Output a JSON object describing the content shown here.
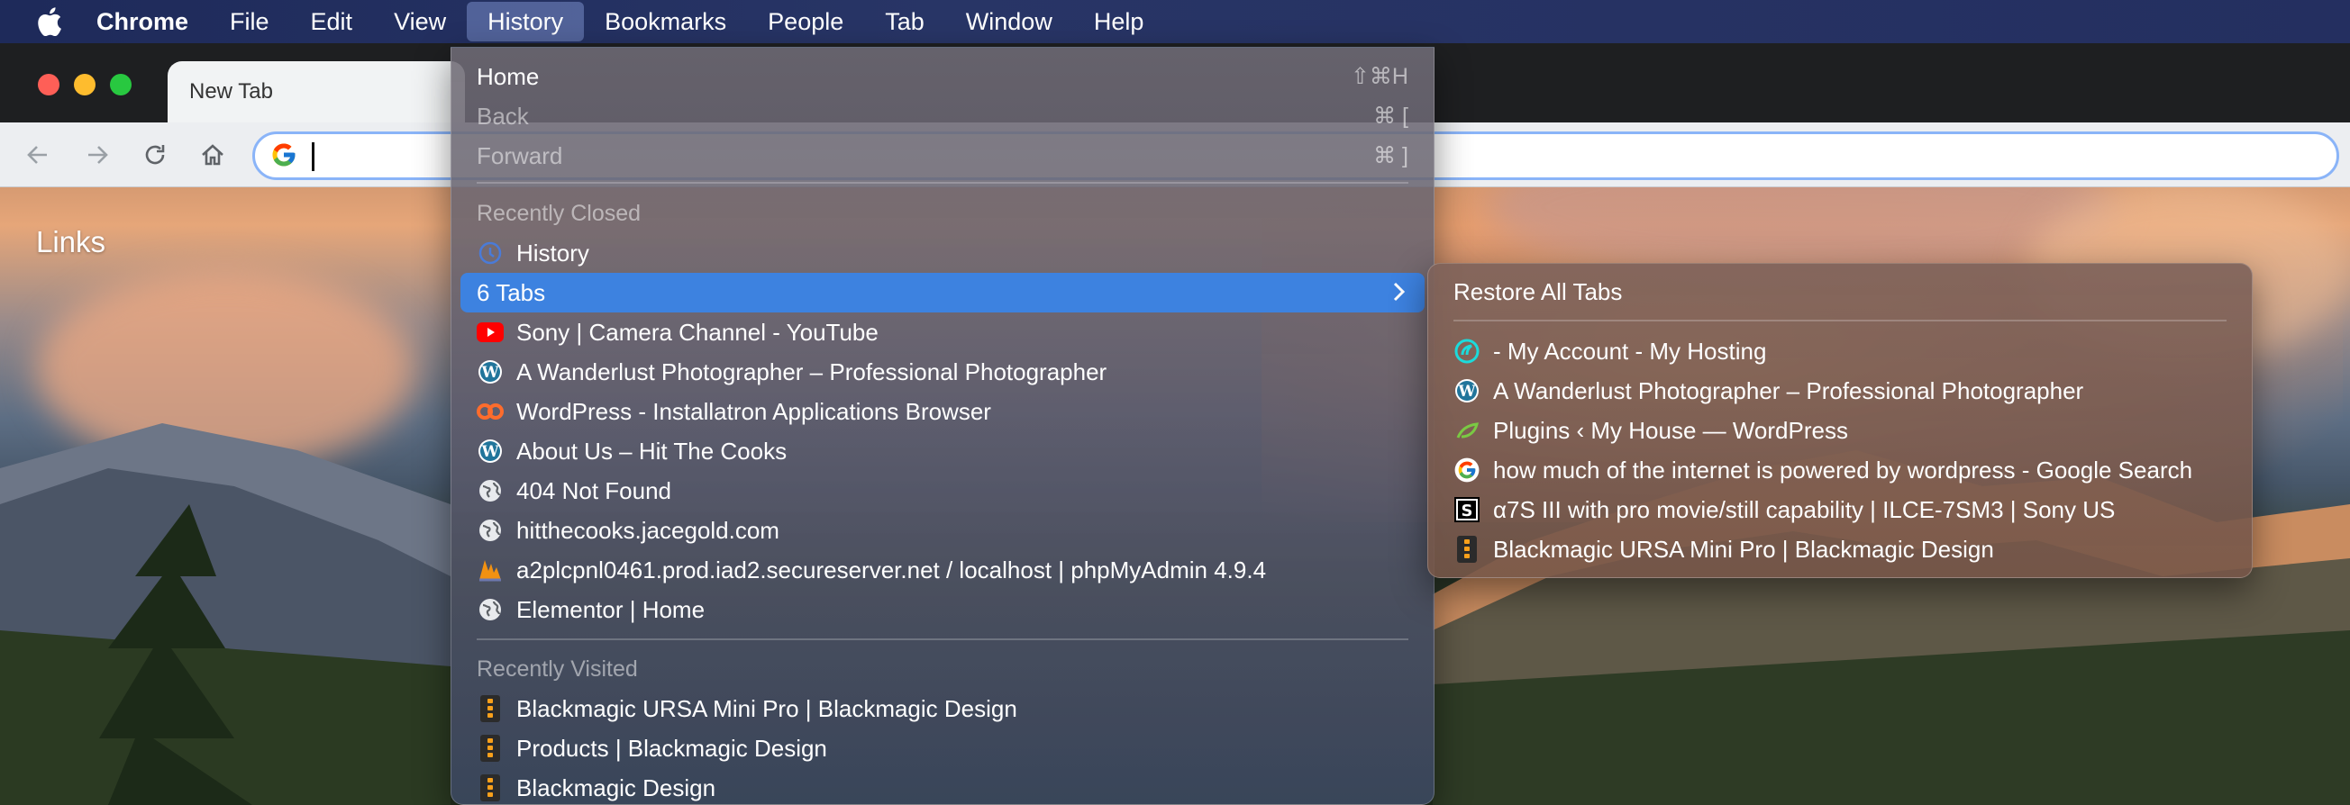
{
  "menubar": {
    "app": "Chrome",
    "items": [
      "File",
      "Edit",
      "View",
      "History",
      "Bookmarks",
      "People",
      "Tab",
      "Window",
      "Help"
    ]
  },
  "browser": {
    "tab_title": "New Tab",
    "omnibox_value": "",
    "links_label": "Links"
  },
  "history_menu": {
    "home": {
      "label": "Home",
      "shortcut": "⇧⌘H"
    },
    "back": {
      "label": "Back",
      "shortcut": "⌘ ["
    },
    "forward": {
      "label": "Forward",
      "shortcut": "⌘ ]"
    },
    "recently_closed_header": "Recently Closed",
    "recently_closed": [
      {
        "label": "History",
        "icon": "history-icon"
      },
      {
        "label": "6 Tabs",
        "icon": ""
      },
      {
        "label": "Sony | Camera Channel - YouTube",
        "icon": "youtube-icon"
      },
      {
        "label": "A Wanderlust Photographer – Professional Photographer",
        "icon": "wordpress-icon"
      },
      {
        "label": "WordPress - Installatron Applications Browser",
        "icon": "cpanel-icon"
      },
      {
        "label": "About Us – Hit The Cooks",
        "icon": "wordpress-icon"
      },
      {
        "label": "404 Not Found",
        "icon": "globe-icon"
      },
      {
        "label": "hitthecooks.jacegold.com",
        "icon": "globe-icon"
      },
      {
        "label": "a2plcpnl0461.prod.iad2.secureserver.net / localhost | phpMyAdmin 4.9.4",
        "icon": "phpmyadmin-icon"
      },
      {
        "label": "Elementor | Home",
        "icon": "globe-icon"
      }
    ],
    "recently_visited_header": "Recently Visited",
    "recently_visited": [
      {
        "label": "Blackmagic URSA Mini Pro | Blackmagic Design",
        "icon": "blackmagic-icon"
      },
      {
        "label": "Products | Blackmagic Design",
        "icon": "blackmagic-icon"
      },
      {
        "label": "Blackmagic Design",
        "icon": "blackmagic-icon"
      }
    ]
  },
  "tabs_submenu": {
    "restore_all": "Restore All Tabs",
    "items": [
      {
        "label": "- My Account - My Hosting",
        "icon": "hosting-icon"
      },
      {
        "label": "A Wanderlust Photographer – Professional Photographer",
        "icon": "wordpress-icon"
      },
      {
        "label": "Plugins ‹ My House — WordPress",
        "icon": "leaf-icon"
      },
      {
        "label": "how much of the internet is powered by wordpress - Google Search",
        "icon": "google-icon"
      },
      {
        "label": "α7S III with pro movie/still capability | ILCE-7SM3 | Sony US",
        "icon": "sony-icon"
      },
      {
        "label": "Blackmagic URSA Mini Pro | Blackmagic Design",
        "icon": "blackmagic-icon"
      }
    ]
  },
  "colors": {
    "menubar": "#242f60",
    "highlight": "#3d82e0",
    "omnibox_focus": "#8ab4f8"
  }
}
